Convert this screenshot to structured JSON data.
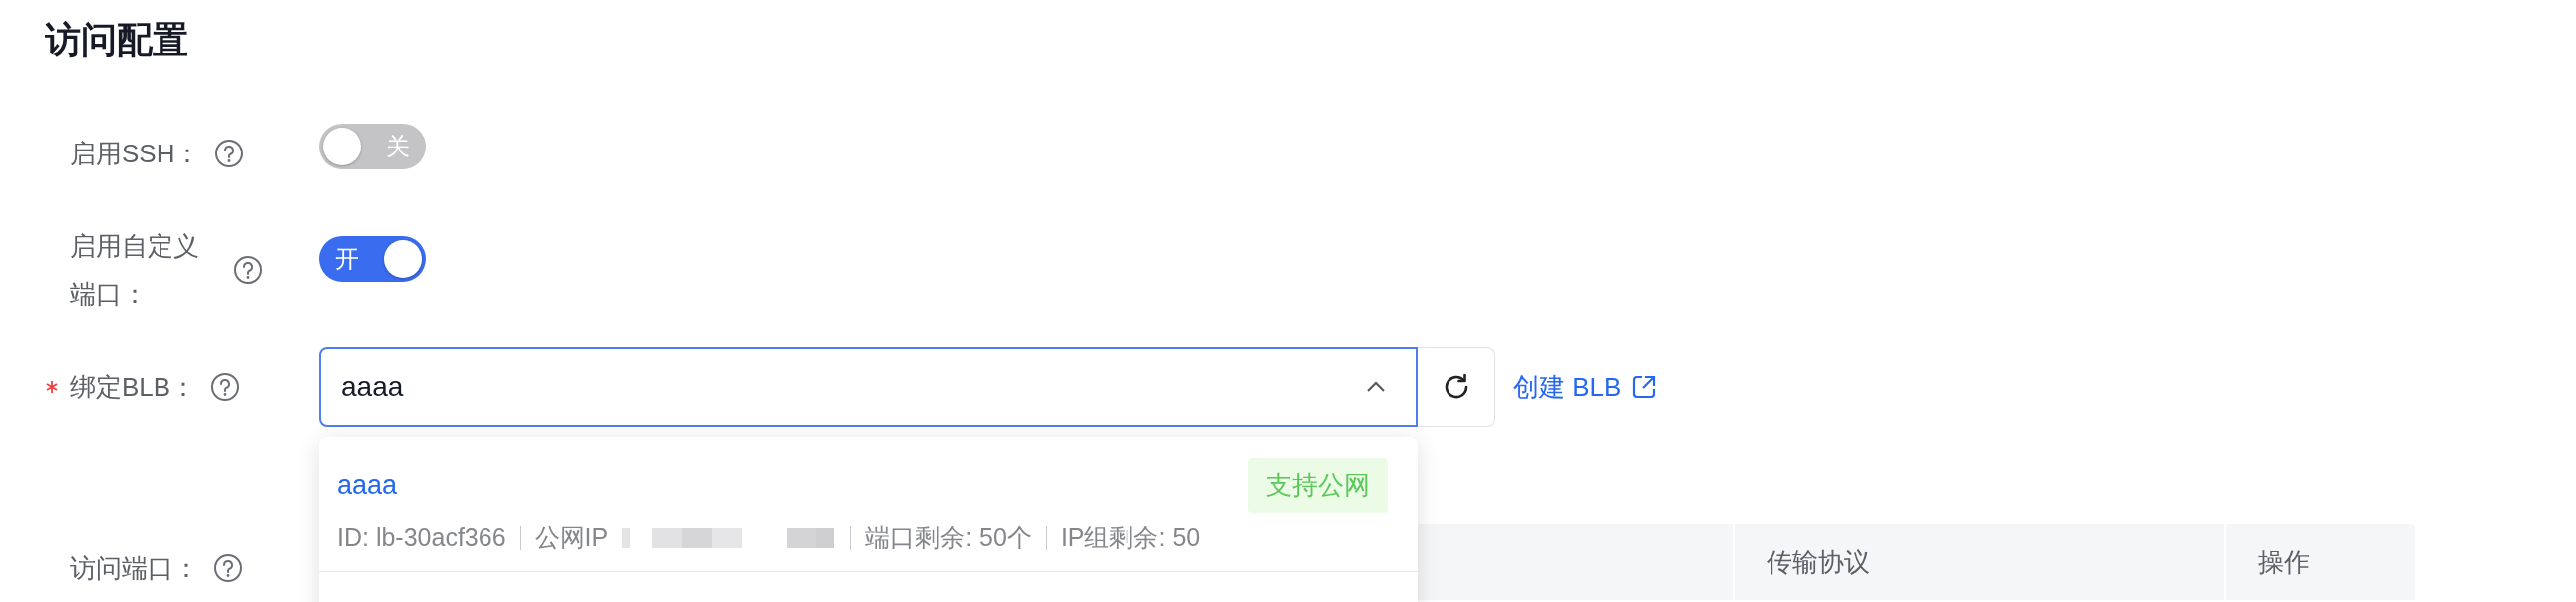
{
  "section_title": "访问配置",
  "fields": [
    {
      "kind": "switch",
      "label": "启用SSH：",
      "required": false,
      "on": false,
      "switch_text": "关"
    },
    {
      "kind": "switch",
      "label": "启用自定义端口：",
      "required": false,
      "on": true,
      "switch_text": "开"
    },
    {
      "kind": "select",
      "label": "绑定BLB：",
      "required": true,
      "value": "aaaa",
      "expanded": true,
      "link": "创建 BLB",
      "options": [
        {
          "name": "aaaa",
          "tag": "支持公网",
          "meta": [
            "ID: lb-30acf366",
            "公网IP",
            "端口剩余: 50个",
            "IP组剩余: 50"
          ]
        }
      ]
    },
    {
      "kind": "table",
      "label": "访问端口：",
      "required": false,
      "columns": [
        "传输协议",
        "操作"
      ]
    }
  ]
}
